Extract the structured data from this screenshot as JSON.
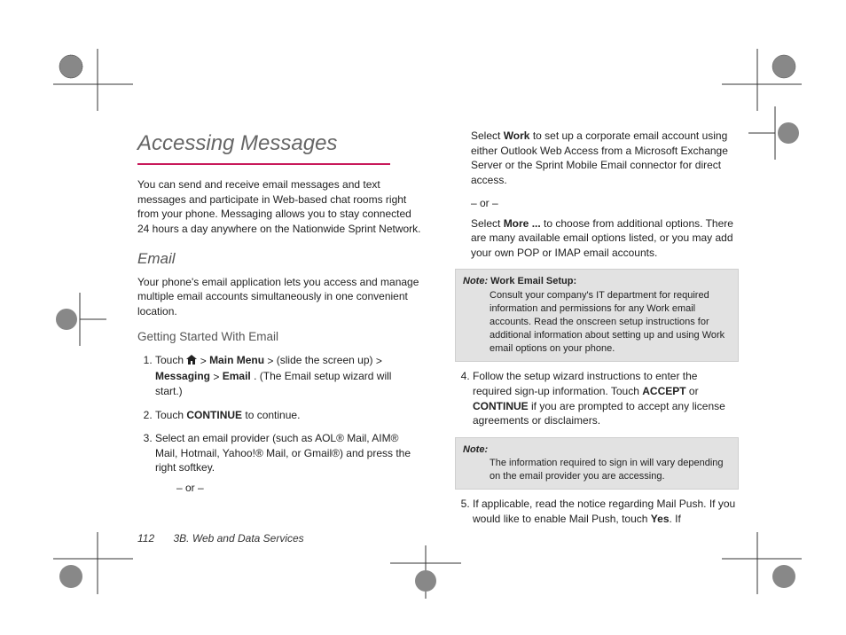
{
  "title": "Accessing Messages",
  "intro": "You can send and receive email messages and text messages and participate in Web-based chat rooms right from your phone. Messaging allows you to stay connected 24 hours a day anywhere on the Nationwide Sprint Network.",
  "h2_email": "Email",
  "email_intro": "Your phone's email application lets you access and manage multiple email accounts simultaneously in one convenient location.",
  "h3_getting": "Getting Started With Email",
  "step1_pre": "Touch ",
  "step1_mainmenu": "Main Menu",
  "step1_mid": " (slide the screen up) ",
  "step1_messaging": "Messaging",
  "step1_email": "Email",
  "step1_tail": ". (The Email setup wizard will start.)",
  "step2_a": "Touch ",
  "step2_b": "CONTINUE",
  "step2_c": " to continue.",
  "step3": "Select an email provider (such as AOL® Mail, AIM® Mail, Hotmail, Yahoo!® Mail, or Gmail®) and press the right softkey.",
  "or_text": "– or –",
  "col2_p1_a": "Select ",
  "col2_p1_b": "Work",
  "col2_p1_c": " to set up a corporate email account using either Outlook Web Access from a Microsoft Exchange Server or the Sprint Mobile Email connector for direct access.",
  "col2_p2_a": "Select ",
  "col2_p2_b": "More ...",
  "col2_p2_c": " to choose from additional options. There are many available email options listed, or you may add your own POP or IMAP email accounts.",
  "note1_label": "Note:",
  "note1_title": "Work Email Setup:",
  "note1_body": " Consult your company's IT department for required information and permissions for any Work email accounts. Read the onscreen setup instructions for additional information about setting up and using Work email options on your phone.",
  "step4_a": "Follow the setup wizard instructions to enter the required sign-up information. Touch ",
  "step4_b": "ACCEPT",
  "step4_c": " or ",
  "step4_d": "CONTINUE",
  "step4_e": " if you are prompted to accept any license agreements or disclaimers.",
  "note2_label": "Note:",
  "note2_body": "The information required to sign in will vary depending on the email provider you are accessing.",
  "step5_a": "If applicable, read the notice regarding Mail Push. If you would like to enable Mail Push, touch ",
  "step5_b": "Yes",
  "step5_c": ". If",
  "footer_page": "112",
  "footer_section": "3B. Web and Data Services"
}
